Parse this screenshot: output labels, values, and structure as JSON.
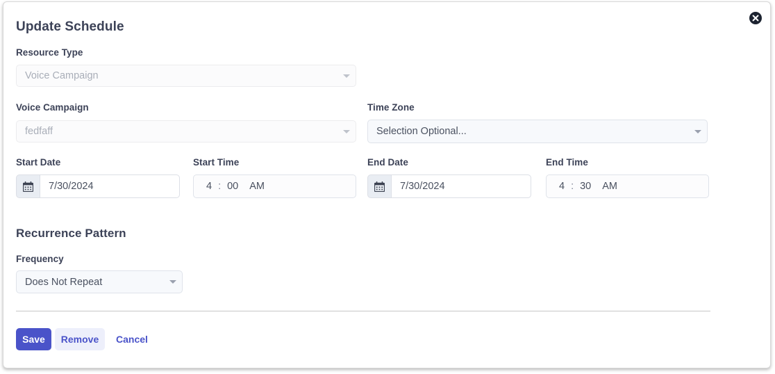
{
  "dialog": {
    "title": "Update Schedule",
    "close_icon": "close-circle-icon"
  },
  "resource_type": {
    "label": "Resource Type",
    "value": "Voice Campaign",
    "caret_icon": "chevron-down-icon"
  },
  "voice_campaign": {
    "label": "Voice Campaign",
    "value": "fedfaff",
    "caret_icon": "chevron-down-icon"
  },
  "time_zone": {
    "label": "Time Zone",
    "value": "Selection Optional...",
    "caret_icon": "chevron-down-icon"
  },
  "start_date": {
    "label": "Start Date",
    "value": "7/30/2024",
    "calendar_icon": "calendar-icon"
  },
  "start_time": {
    "label": "Start Time",
    "hour": "4",
    "separator": ":",
    "minute": "00",
    "meridiem": "AM"
  },
  "end_date": {
    "label": "End Date",
    "value": "7/30/2024",
    "calendar_icon": "calendar-icon"
  },
  "end_time": {
    "label": "End Time",
    "hour": "4",
    "separator": ":",
    "minute": "30",
    "meridiem": "AM"
  },
  "recurrence": {
    "section_title": "Recurrence Pattern",
    "frequency_label": "Frequency",
    "frequency_value": "Does Not Repeat",
    "caret_icon": "chevron-down-icon"
  },
  "footer": {
    "save_label": "Save",
    "remove_label": "Remove",
    "cancel_label": "Cancel"
  },
  "colors": {
    "accent": "#4a53c9",
    "accent_soft": "#edeffb",
    "text_dark": "#3c4257",
    "text_muted": "#a9aeb8"
  }
}
